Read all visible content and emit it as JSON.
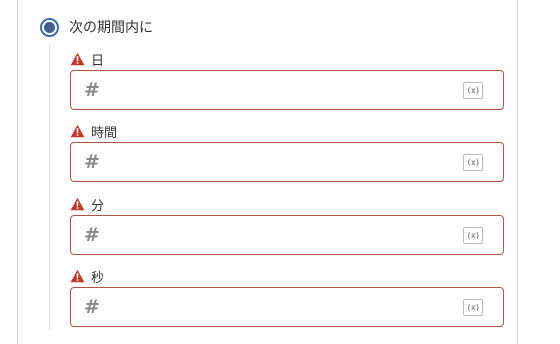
{
  "option": {
    "label": "次の期間内に",
    "selected": true
  },
  "fields": [
    {
      "label": "日",
      "value": "",
      "type_icon": "hash-icon",
      "variable_icon": "(x)"
    },
    {
      "label": "時間",
      "value": "",
      "type_icon": "hash-icon",
      "variable_icon": "(x)"
    },
    {
      "label": "分",
      "value": "",
      "type_icon": "hash-icon",
      "variable_icon": "(x)"
    },
    {
      "label": "秒",
      "value": "",
      "type_icon": "hash-icon",
      "variable_icon": "(x)"
    }
  ],
  "icons": {
    "hash": "#",
    "warning": "warning-icon"
  },
  "colors": {
    "error_border": "#b4533f",
    "warning": "#c0392b",
    "radio": "#3f5f8f",
    "icon_gray": "#8a8a8a"
  }
}
